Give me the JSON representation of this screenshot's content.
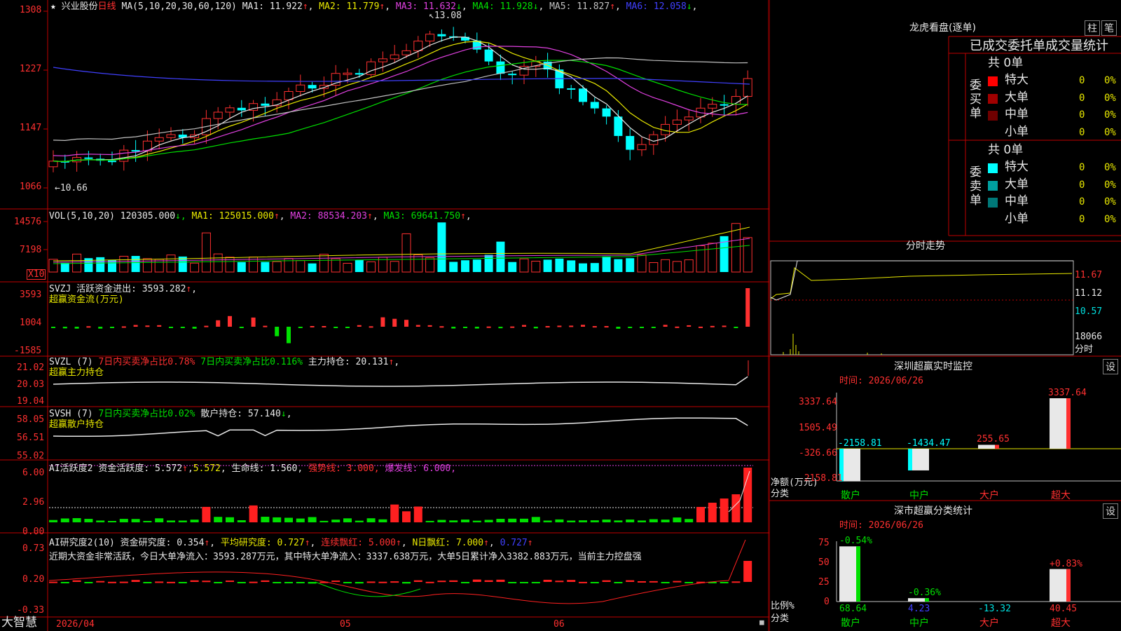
{
  "header": {
    "star": "★",
    "stock_name": "兴业股份",
    "period": "日线",
    "ma_label": "MA(5,10,20,30,60,120)",
    "ma": [
      {
        "label": "MA1:",
        "value": "11.922",
        "arrow": "↑",
        "color": "#e8e8e8"
      },
      {
        "label": "MA2:",
        "value": "11.779",
        "arrow": "↑",
        "color": "#e8e800"
      },
      {
        "label": "MA3:",
        "value": "11.632",
        "arrow": "↓",
        "color": "#e040e0"
      },
      {
        "label": "MA4:",
        "value": "11.928",
        "arrow": "↓",
        "color": "#00e000"
      },
      {
        "label": "MA5:",
        "value": "11.827",
        "arrow": "↑",
        "color": "#c0c0c0"
      },
      {
        "label": "MA6:",
        "value": "12.058",
        "arrow": "↓",
        "color": "#4040ff"
      }
    ],
    "high_marker": "13.08",
    "low_marker": "←10.66"
  },
  "price_axis": [
    "1308",
    "1227",
    "1147",
    "1066"
  ],
  "vol_panel": {
    "title": "VOL(5,10,20)",
    "value": "120305.000",
    "ma": [
      {
        "label": "MA1:",
        "value": "125015.000",
        "arrow": "↑",
        "color": "#e8e800"
      },
      {
        "label": "MA2:",
        "value": "88534.203",
        "arrow": "↑",
        "color": "#e040e0"
      },
      {
        "label": "MA3:",
        "value": "69641.750",
        "arrow": "↑",
        "color": "#00e000"
      }
    ],
    "axis": [
      "14576",
      "7198"
    ],
    "unit": "X10"
  },
  "svzj_panel": {
    "title": "SVZJ",
    "label": "活跃资金进出:",
    "value": "3593.282",
    "subtitle": "超赢资金流(万元)",
    "axis": [
      "3593",
      "1004",
      "-1585"
    ]
  },
  "svzl_panel": {
    "title": "SVZL (7)",
    "t1": "7日内买卖净占比0.78%",
    "t2": "7日内买卖净占比0.116%",
    "t3": "主力持仓:",
    "value": "20.131",
    "subtitle": "超赢主力持仓",
    "axis": [
      "21.02",
      "20.03",
      "19.04"
    ]
  },
  "svsh_panel": {
    "title": "SVSH (7)",
    "t1": "7日内买卖净占比0.02%",
    "t2": "散户持仓:",
    "value": "57.140",
    "subtitle": "超赢散户持仓",
    "axis": [
      "58.05",
      "56.51",
      "55.02"
    ]
  },
  "ai_panel": {
    "title": "AI活跃度2",
    "label": "资金活跃度:",
    "v1": "5.572",
    "v2": "5.572",
    "life": "生命线: 1.560,",
    "strong": "强势线: 3.000,",
    "burst": "爆发线: 6.000,",
    "axis": [
      "6.00",
      "2.96",
      "0.00"
    ]
  },
  "research_panel": {
    "title": "AI研究度2(10)",
    "label": "资金研究度:",
    "v1": "0.354",
    "avg": "平均研究度: 0.727",
    "cont": "连续飘红: 5.000",
    "nday": "N日飘红: 7.000",
    "last": "0.727",
    "summary": "近期大资金非常活跃，今日大单净流入：3593.287万元，其中特大单净流入：3337.638万元，大单5日累计净入3382.883万元，当前主力控盘强",
    "axis": [
      "0.73",
      "0.20",
      "-0.33"
    ]
  },
  "bottom": {
    "brand": "大智慧",
    "date": "2026/04",
    "months": [
      "05",
      "06"
    ]
  },
  "right_panel": {
    "title": "龙虎看盘(逐单)",
    "btn1": "柱",
    "btn2": "笔",
    "tabs": "已成交委托单成交量统计",
    "buy_label": "委买单",
    "sell_label": "委卖单",
    "buy_total": "共 0单",
    "sell_total": "共 0单",
    "buy_rows": [
      {
        "name": "特大",
        "count": "0",
        "pct": "0%",
        "color": "#ff0000"
      },
      {
        "name": "大单",
        "count": "0",
        "pct": "0%",
        "color": "#a00000"
      },
      {
        "name": "中单",
        "count": "0",
        "pct": "0%",
        "color": "#700000"
      },
      {
        "name": "小单",
        "count": "0",
        "pct": "0%",
        "color": ""
      }
    ],
    "sell_rows": [
      {
        "name": "特大",
        "count": "0",
        "pct": "0%",
        "color": "#00ffff"
      },
      {
        "name": "大单",
        "count": "0",
        "pct": "0%",
        "color": "#00a0a0"
      },
      {
        "name": "中单",
        "count": "0",
        "pct": "0%",
        "color": "#007878"
      },
      {
        "name": "小单",
        "count": "0",
        "pct": "0%",
        "color": ""
      }
    ],
    "intraday_title": "分时走势",
    "intraday_axis": [
      "11.67",
      "11.12",
      "10.57",
      "18066",
      "分时"
    ],
    "monitor_title": "深圳超赢实时监控",
    "monitor_btn": "设",
    "monitor_time": "时间: 2026/06/26",
    "monitor_axis": [
      "3337.64",
      "1505.49",
      "-326.66",
      "-2158.81"
    ],
    "monitor_ylabel1": "净额(万元)",
    "monitor_ylabel2": "分类",
    "monitor_bars": [
      {
        "cat": "散户",
        "value": "-2158.81"
      },
      {
        "cat": "中户",
        "value": "-1434.47"
      },
      {
        "cat": "大户",
        "value": "255.65"
      },
      {
        "cat": "超大",
        "value": "3337.64"
      }
    ],
    "class_title": "深市超赢分类统计",
    "class_btn": "设",
    "class_time": "时间: 2026/06/26",
    "class_axis": [
      "75",
      "50",
      "25",
      "0"
    ],
    "class_ylabel1": "比例%",
    "class_ylabel2": "分类",
    "class_bars": [
      {
        "cat": "散户",
        "value": "68.64",
        "delta": "-0.54%"
      },
      {
        "cat": "中户",
        "value": "4.23",
        "delta": "-0.36%"
      },
      {
        "cat": "大户",
        "value": "-13.32",
        "delta": ""
      },
      {
        "cat": "超大",
        "value": "40.45",
        "delta": "+0.83%"
      }
    ]
  },
  "colors": {
    "up": "#ff3030",
    "down": "#00ffff",
    "grid": "#c00000",
    "axis_text": "#ff3030"
  }
}
